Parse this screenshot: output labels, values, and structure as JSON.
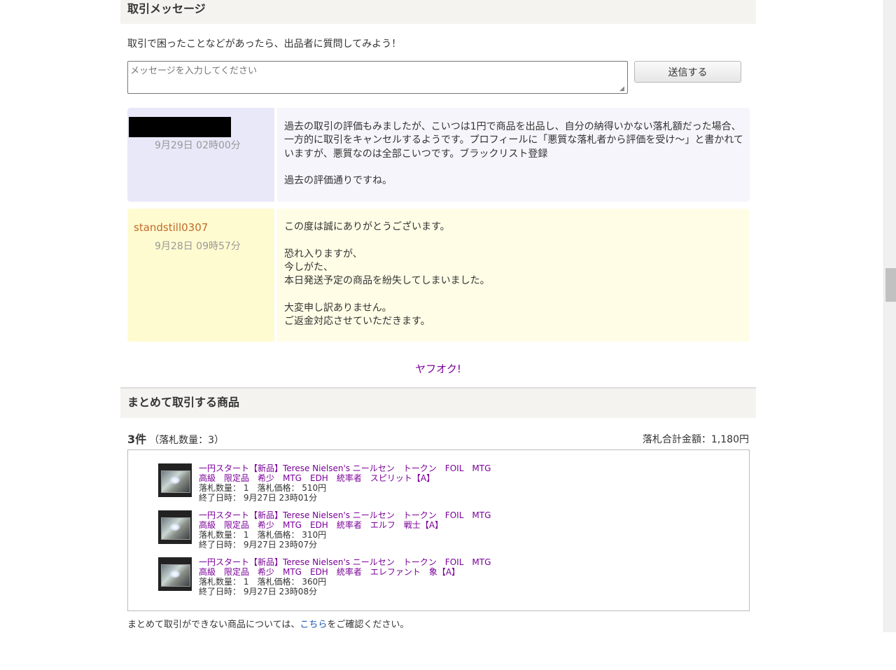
{
  "header": {
    "title": "取引メッセージ"
  },
  "intro": "取引で困ったことなどがあったら、出品者に質問してみよう！",
  "message_form": {
    "placeholder": "メッセージを入力してください",
    "send_label": "送信する"
  },
  "messages": [
    {
      "sender": "",
      "sender_redacted": true,
      "date": "9月29日 02時00分",
      "text": "過去の取引の評価もみましたが、こいつは1円で商品を出品し、自分の納得いかない落札額だった場合、一方的に取引をキャンセルするようです。プロフィールに「悪質な落札者から評価を受け～」と書かれていますが、悪質なのは全部こいつです。ブラックリスト登録\n\n過去の評価通りですね。"
    },
    {
      "sender": "standstill0307",
      "date": "9月28日 09時57分",
      "text": "この度は誠にありがとうございます。\n\n恐れ入りますが、\n今しがた、\n本日発送予定の商品を紛失してしまいました。\n\n大変申し訳ありません。\nご返金対応させていただきます。"
    }
  ],
  "yahoo_link": "ヤフオク!",
  "bundle": {
    "title": "まとめて取引する商品",
    "count": "3件",
    "count_sub": "（落札数量：3）",
    "total": "落札合計金額：1,180円",
    "items": [
      {
        "title": "一円スタート【新品】Terese Nielsen's ニールセン　トークン　FOIL　MTG　高級　限定品　希少　MTG　EDH　統率者　スピリット【A】",
        "qty_price": "落札数量： 1　落札価格： 510円",
        "end": "終了日時： 9月27日 23時01分"
      },
      {
        "title": "一円スタート【新品】Terese Nielsen's ニールセン　トークン　FOIL　MTG　高級　限定品　希少　MTG　EDH　統率者　エルフ　戦士【A】",
        "qty_price": "落札数量： 1　落札価格： 310円",
        "end": "終了日時： 9月27日 23時07分"
      },
      {
        "title": "一円スタート【新品】Terese Nielsen's ニールセン　トークン　FOIL　MTG　高級　限定品　希少　MTG　EDH　統率者　エレファント　象【A】",
        "qty_price": "落札数量： 1　落札価格： 360円",
        "end": "終了日時： 9月27日 23時08分"
      }
    ]
  },
  "footnote": {
    "before": "まとめて取引ができない商品については、",
    "link": "こちら",
    "after": "をご確認ください。"
  }
}
